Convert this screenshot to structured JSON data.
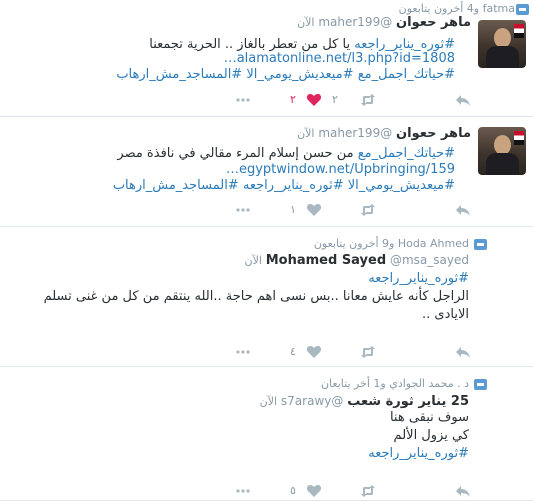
{
  "tweets": [
    {
      "context": "fatma و4 أخرون يتابعون",
      "fullname": "ماهر حعوان",
      "screen_name": "@maher199",
      "time": "الآن",
      "lines": [
        [
          {
            "t": "#ثوره_يناير_راجعه",
            "k": "tag"
          },
          {
            "t": "  يا كل من تعطر بالغاز .. الحرية تجمعنا",
            "k": "text"
          }
        ],
        [
          {
            "t": "alamatonline.net/l3.php?id=1808…",
            "k": "link"
          }
        ],
        [
          {
            "t": "#حياتك_اجمل_مع",
            "k": "tag"
          },
          {
            "t": " ",
            "k": "text"
          },
          {
            "t": "#ميعديش_يومي_الا",
            "k": "tag"
          },
          {
            "t": " ",
            "k": "text"
          },
          {
            "t": "#المساجد_مش_ارهاب",
            "k": "tag"
          }
        ]
      ],
      "retweets": "٢",
      "likes": "٢",
      "liked": true
    },
    {
      "context": "",
      "fullname": "ماهر حعوان",
      "screen_name": "@maher199",
      "time": "الآن",
      "lines": [
        [
          {
            "t": "#حياتك_اجمل_مع",
            "k": "tag"
          },
          {
            "t": "   من حسن إسلام المرء مقالي في نافذة مصر",
            "k": "text"
          }
        ],
        [
          {
            "t": "egyptwindow.net/Upbringing/159…",
            "k": "link"
          }
        ],
        [
          {
            "t": "#ميعديش_يومي_الا",
            "k": "tag"
          },
          {
            "t": " ",
            "k": "text"
          },
          {
            "t": "#ثوره_يناير_راجعه",
            "k": "tag"
          },
          {
            "t": " ",
            "k": "text"
          },
          {
            "t": "#المساجد_مش_ارهاب",
            "k": "tag"
          }
        ]
      ],
      "retweets": "",
      "likes": "١",
      "liked": false
    },
    {
      "context": "Hoda Ahmed و9 أخرون يتابعون",
      "fullname": "Mohamed Sayed",
      "screen_name": "@msa_sayed",
      "time": "الآن",
      "lines": [
        [
          {
            "t": "#ثوره_يناير_راجعه",
            "k": "tag"
          }
        ],
        [
          {
            "t": "الراجل كأنه عايش معانا ..بس نسى اهم حاجة ..الله ينتقم من كل من غنى تسلم",
            "k": "text"
          }
        ],
        [
          {
            "t": "الايادى ..",
            "k": "text"
          }
        ]
      ],
      "retweets": "",
      "likes": "٤",
      "liked": false
    },
    {
      "context": "د . محمد الجوادي و1 أخر يتابعان",
      "fullname": "25 يناير ثورة شعب",
      "screen_name": "@s7arawy",
      "time": "الآن",
      "lines": [
        [
          {
            "t": "سوف نبقى هنا",
            "k": "text"
          }
        ],
        [
          {
            "t": "كي يزول الألم",
            "k": "text"
          }
        ],
        [
          {
            "t": "#ثوره_يناير_راجعه",
            "k": "tag"
          }
        ]
      ],
      "retweets": "",
      "likes": "٥",
      "liked": false
    }
  ],
  "icons": {
    "reply": "reply-icon",
    "retweet": "retweet-icon",
    "like": "heart-icon",
    "more": "more-icon",
    "follow_context": "follow-context-icon",
    "verified_heart": "heart-icon"
  },
  "colors": {
    "link": "#2b7bb9",
    "like_active": "#e0245e",
    "muted": "#8899a6",
    "action": "#aab8c2"
  }
}
